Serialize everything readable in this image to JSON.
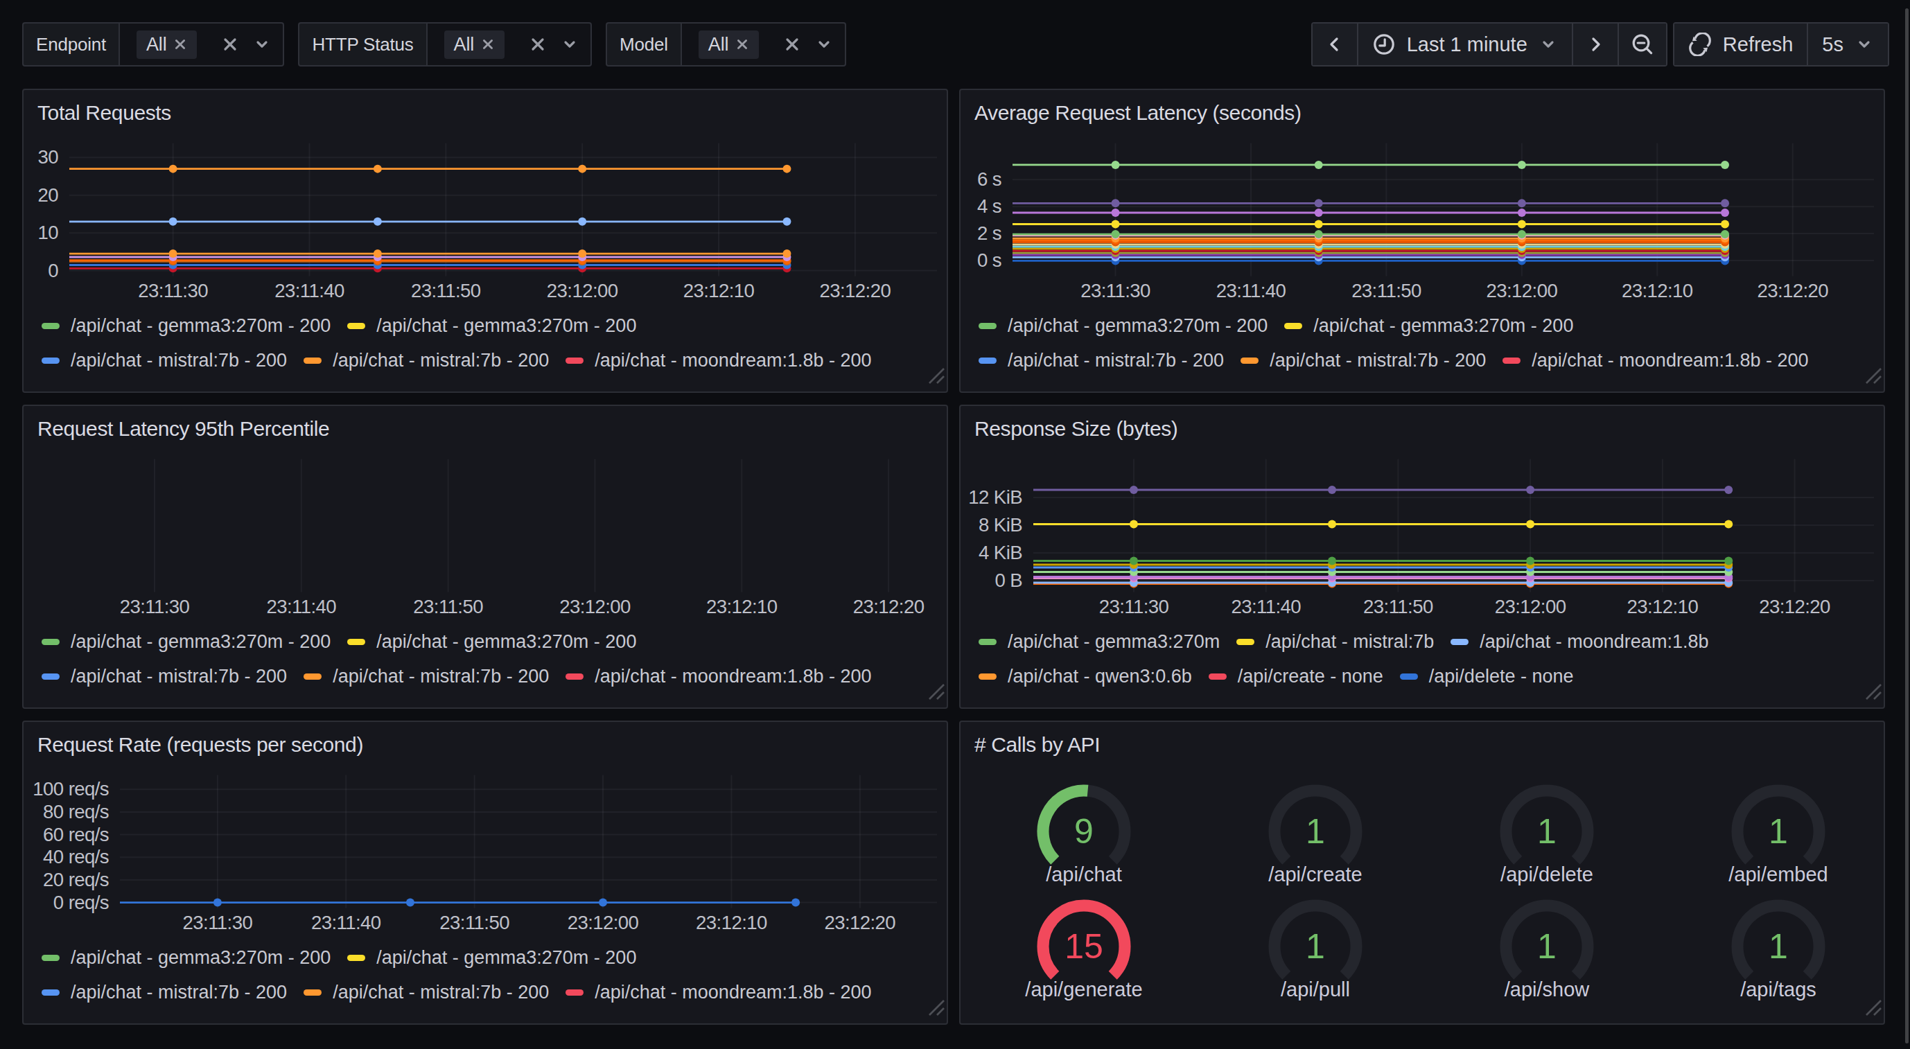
{
  "toolbar": {
    "filters": [
      {
        "label": "Endpoint",
        "value": "All"
      },
      {
        "label": "HTTP Status",
        "value": "All"
      },
      {
        "label": "Model",
        "value": "All"
      }
    ],
    "time_range_label": "Last 1 minute",
    "refresh_label": "Refresh",
    "refresh_interval": "5s"
  },
  "icons": {
    "clock-icon": "clock face with hands",
    "chevron-left-icon": "‹",
    "chevron-right-icon": "›",
    "chevron-down-icon": "v caret",
    "close-icon": "x",
    "zoom-out-icon": "magnifier with minus",
    "refresh-icon": "circular sync arrow",
    "resize-handle-icon": "double diagonal corner lines"
  },
  "colors": {
    "page_bg": "#0c0d11",
    "panel_bg": "#16171d",
    "panel_border": "#27292f",
    "text": "#c9cad3",
    "title": "#dadbe3",
    "grid": "rgba(204,204,220,0.07)",
    "gauge_track": "#24262d",
    "green": "#73BF69",
    "red": "#F2495C"
  },
  "chart_data": [
    {
      "type": "line",
      "title": "Total Requests",
      "panel": 0,
      "axis_left": 33,
      "x_tick_labels": [
        "23:11:30",
        "23:11:40",
        "23:11:50",
        "23:12:00",
        "23:12:10",
        "23:12:20"
      ],
      "point_times": [
        "23:11:30",
        "23:11:45",
        "23:12:00",
        "23:12:15"
      ],
      "x_range": [
        "23:11:22.4",
        "23:12:26"
      ],
      "y_ticks": [
        {
          "v": 0,
          "label": "0"
        },
        {
          "v": 10,
          "label": "10"
        },
        {
          "v": 20,
          "label": "20"
        },
        {
          "v": 30,
          "label": "30"
        }
      ],
      "y_top": 32.7,
      "grid": {
        "horizontal": true,
        "vertical": true
      },
      "series": [
        {
          "color": "#FF9830",
          "value": 27
        },
        {
          "color": "#8AB8FF",
          "value": 13
        },
        {
          "color": "#FF9830",
          "value": 4.5
        },
        {
          "color": "#CA95E5",
          "value": 3.6
        },
        {
          "color": "#FA6400",
          "value": 2.75
        },
        {
          "color": "#C26419",
          "value": 2.45
        },
        {
          "color": "#3274D9",
          "value": 1.5
        },
        {
          "color": "#C4162A",
          "value": 0.6
        }
      ],
      "legend_rows": [
        [
          {
            "color": "#73BF69",
            "label": "/api/chat - gemma3:270m - 200"
          },
          {
            "color": "#FADE2A",
            "label": "/api/chat - gemma3:270m - 200"
          }
        ],
        [
          {
            "color": "#5794F2",
            "label": "/api/chat - mistral:7b - 200"
          },
          {
            "color": "#FF9830",
            "label": "/api/chat - mistral:7b - 200"
          },
          {
            "color": "#F2495C",
            "label": "/api/chat - moondream:1.8b - 200"
          }
        ]
      ]
    },
    {
      "type": "line",
      "title": "Average Request Latency (seconds)",
      "panel": 1,
      "axis_left": 37.5,
      "x_tick_labels": [
        "23:11:30",
        "23:11:40",
        "23:11:50",
        "23:12:00",
        "23:12:10",
        "23:12:20"
      ],
      "point_times": [
        "23:11:30",
        "23:11:45",
        "23:12:00",
        "23:12:15"
      ],
      "x_range": [
        "23:11:22.4",
        "23:12:26"
      ],
      "y_ticks": [
        {
          "v": 0,
          "label": "0 s"
        },
        {
          "v": 2,
          "label": "2 s"
        },
        {
          "v": 4,
          "label": "4 s"
        },
        {
          "v": 6,
          "label": "6 s"
        }
      ],
      "y_min": -0.75,
      "y_top": 8.4,
      "grid": {
        "horizontal": true,
        "vertical": true
      },
      "series": [
        {
          "color": "#96D98D",
          "value": 7.1
        },
        {
          "color": "#705DA0",
          "value": 4.25
        },
        {
          "color": "#B877D9",
          "value": 3.55
        },
        {
          "color": "#FADE2A",
          "value": 2.7
        },
        {
          "color": "#73BF69",
          "value": 1.95
        },
        {
          "color": "#F7A8C4",
          "value": 1.86
        },
        {
          "color": "#FF9830",
          "value": 1.64
        },
        {
          "color": "#FA6400",
          "value": 1.5
        },
        {
          "color": "#E55400",
          "value": 1.36
        },
        {
          "color": "#E8D48B",
          "value": 1.18
        },
        {
          "color": "#6ED0E0",
          "value": 1.02
        },
        {
          "color": "#CCA300",
          "value": 0.88
        },
        {
          "color": "#C4162A",
          "value": 0.72
        },
        {
          "color": "#9E9E3C",
          "value": 0.56
        },
        {
          "color": "#8F3BB8",
          "value": 0.42
        },
        {
          "color": "#8AB8FF",
          "value": 0.24
        },
        {
          "color": "#1F60C4",
          "value": -0.02
        }
      ],
      "legend_rows": [
        [
          {
            "color": "#73BF69",
            "label": "/api/chat - gemma3:270m - 200"
          },
          {
            "color": "#FADE2A",
            "label": "/api/chat - gemma3:270m - 200"
          }
        ],
        [
          {
            "color": "#5794F2",
            "label": "/api/chat - mistral:7b - 200"
          },
          {
            "color": "#FF9830",
            "label": "/api/chat - mistral:7b - 200"
          },
          {
            "color": "#F2495C",
            "label": "/api/chat - moondream:1.8b - 200"
          }
        ]
      ]
    },
    {
      "type": "line",
      "title": "Request Latency 95th Percentile",
      "panel": 2,
      "axis_left": 14,
      "x_tick_labels": [
        "23:11:30",
        "23:11:40",
        "23:11:50",
        "23:12:00",
        "23:12:10",
        "23:12:20"
      ],
      "point_times": [],
      "x_range": [
        "23:11:22.4",
        "23:12:23.3"
      ],
      "y_ticks": [],
      "y_top": 1,
      "grid": {
        "horizontal": false,
        "vertical": true
      },
      "series": [],
      "legend_rows": [
        [
          {
            "color": "#73BF69",
            "label": "/api/chat - gemma3:270m - 200"
          },
          {
            "color": "#FADE2A",
            "label": "/api/chat - gemma3:270m - 200"
          }
        ],
        [
          {
            "color": "#5794F2",
            "label": "/api/chat - mistral:7b - 200"
          },
          {
            "color": "#FF9830",
            "label": "/api/chat - mistral:7b - 200"
          },
          {
            "color": "#F2495C",
            "label": "/api/chat - moondream:1.8b - 200"
          }
        ]
      ]
    },
    {
      "type": "line",
      "title": "Response Size (bytes)",
      "panel": 3,
      "axis_left": 52.5,
      "x_tick_labels": [
        "23:11:30",
        "23:11:40",
        "23:11:50",
        "23:12:00",
        "23:12:10",
        "23:12:20"
      ],
      "point_times": [
        "23:11:30",
        "23:11:45",
        "23:12:00",
        "23:12:15"
      ],
      "x_range": [
        "23:11:22.4",
        "23:12:26"
      ],
      "y_ticks": [
        {
          "v": 0,
          "label": "0 B"
        },
        {
          "v": 4,
          "label": "4 KiB"
        },
        {
          "v": 8,
          "label": "8 KiB"
        },
        {
          "v": 12,
          "label": "12 KiB"
        }
      ],
      "y_min": -0.86,
      "y_top": 16.94,
      "grid": {
        "horizontal": true,
        "vertical": true
      },
      "series": [
        {
          "color": "#705DA0",
          "value": 13.1
        },
        {
          "color": "#FADE2A",
          "value": 8.15
        },
        {
          "color": "#4E9E44",
          "value": 2.85
        },
        {
          "color": "#CCA300",
          "value": 2.3
        },
        {
          "color": "#5794F2",
          "value": 1.9
        },
        {
          "color": "#96D98D",
          "value": 1.25
        },
        {
          "color": "#B877D9",
          "value": 0.55
        },
        {
          "color": "#E389C9",
          "value": 0.35
        },
        {
          "color": "#8AB8FF",
          "value": -0.3
        },
        {
          "color": "#FA6400",
          "value": -0.45
        }
      ],
      "legend_rows": [
        [
          {
            "color": "#73BF69",
            "label": "/api/chat - gemma3:270m"
          },
          {
            "color": "#FADE2A",
            "label": "/api/chat - mistral:7b"
          },
          {
            "color": "#8AB8FF",
            "label": "/api/chat - moondream:1.8b"
          }
        ],
        [
          {
            "color": "#FF9830",
            "label": "/api/chat - qwen3:0.6b"
          },
          {
            "color": "#F2495C",
            "label": "/api/create - none"
          },
          {
            "color": "#3274D9",
            "label": "/api/delete - none"
          }
        ]
      ]
    },
    {
      "type": "line",
      "title": "Request Rate (requests per second)",
      "panel": 4,
      "axis_left": 69.5,
      "x_tick_labels": [
        "23:11:30",
        "23:11:40",
        "23:11:50",
        "23:12:00",
        "23:12:10",
        "23:12:20"
      ],
      "point_times": [
        "23:11:30",
        "23:11:45",
        "23:12:00",
        "23:12:15"
      ],
      "x_range": [
        "23:11:22.4",
        "23:12:26"
      ],
      "y_ticks": [
        {
          "v": 0,
          "label": "0 req/s"
        },
        {
          "v": 20,
          "label": "20 req/s"
        },
        {
          "v": 40,
          "label": "40 req/s"
        },
        {
          "v": 60,
          "label": "60 req/s"
        },
        {
          "v": 80,
          "label": "80 req/s"
        },
        {
          "v": 100,
          "label": "100 req/s"
        }
      ],
      "y_top": 109,
      "grid": {
        "horizontal": true,
        "vertical": true
      },
      "series": [
        {
          "color": "#3274D9",
          "value": 0
        }
      ],
      "legend_rows": [
        [
          {
            "color": "#73BF69",
            "label": "/api/chat - gemma3:270m - 200"
          },
          {
            "color": "#FADE2A",
            "label": "/api/chat - gemma3:270m - 200"
          }
        ],
        [
          {
            "color": "#5794F2",
            "label": "/api/chat - mistral:7b - 200"
          },
          {
            "color": "#FF9830",
            "label": "/api/chat - mistral:7b - 200"
          },
          {
            "color": "#F2495C",
            "label": "/api/chat - moondream:1.8b - 200"
          }
        ]
      ]
    },
    {
      "type": "gauge",
      "title": "# Calls by API",
      "panel": 5,
      "items": [
        {
          "label": "/api/chat",
          "value": 9,
          "color": "#73BF69",
          "arc_fraction": 0.52
        },
        {
          "label": "/api/create",
          "value": 1,
          "color": "#73BF69",
          "arc_fraction": 0
        },
        {
          "label": "/api/delete",
          "value": 1,
          "color": "#73BF69",
          "arc_fraction": 0
        },
        {
          "label": "/api/embed",
          "value": 1,
          "color": "#73BF69",
          "arc_fraction": 0
        },
        {
          "label": "/api/generate",
          "value": 15,
          "color": "#F2495C",
          "arc_fraction": 1
        },
        {
          "label": "/api/pull",
          "value": 1,
          "color": "#73BF69",
          "arc_fraction": 0
        },
        {
          "label": "/api/show",
          "value": 1,
          "color": "#73BF69",
          "arc_fraction": 0
        },
        {
          "label": "/api/tags",
          "value": 1,
          "color": "#73BF69",
          "arc_fraction": 0
        }
      ]
    }
  ]
}
